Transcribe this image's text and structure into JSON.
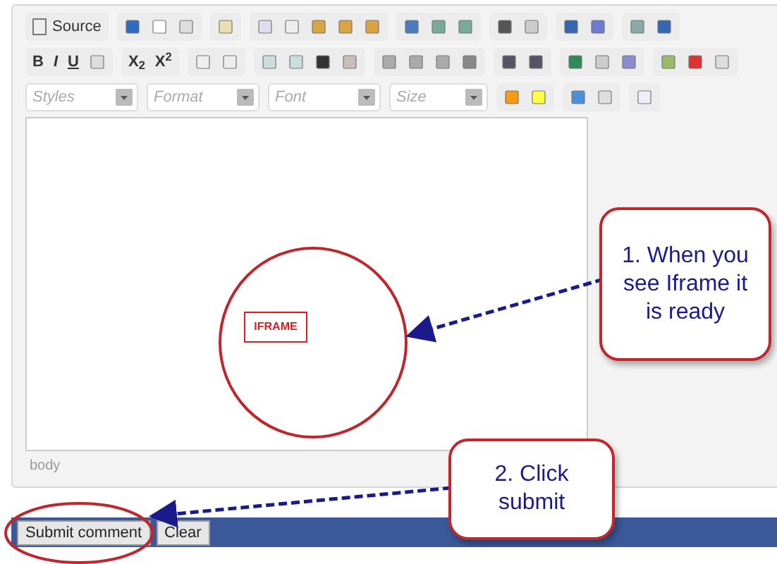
{
  "toolbar": {
    "source_button": "Source",
    "format_buttons": [
      "B",
      "I",
      "U"
    ],
    "script_buttons": [
      "X$_{2}$",
      "X$^{2}$"
    ],
    "dropdowns": [
      {
        "placeholder": "Styles"
      },
      {
        "placeholder": "Format"
      },
      {
        "placeholder": "Font"
      },
      {
        "placeholder": "Size"
      }
    ]
  },
  "editor": {
    "iframe_label": "IFRAME",
    "status_path": "body"
  },
  "buttons": [
    "Submit comment",
    "Clear"
  ],
  "callouts": [
    {
      "text": "1. When you see Iframe it is ready"
    },
    {
      "text": "2. Click submit"
    }
  ]
}
